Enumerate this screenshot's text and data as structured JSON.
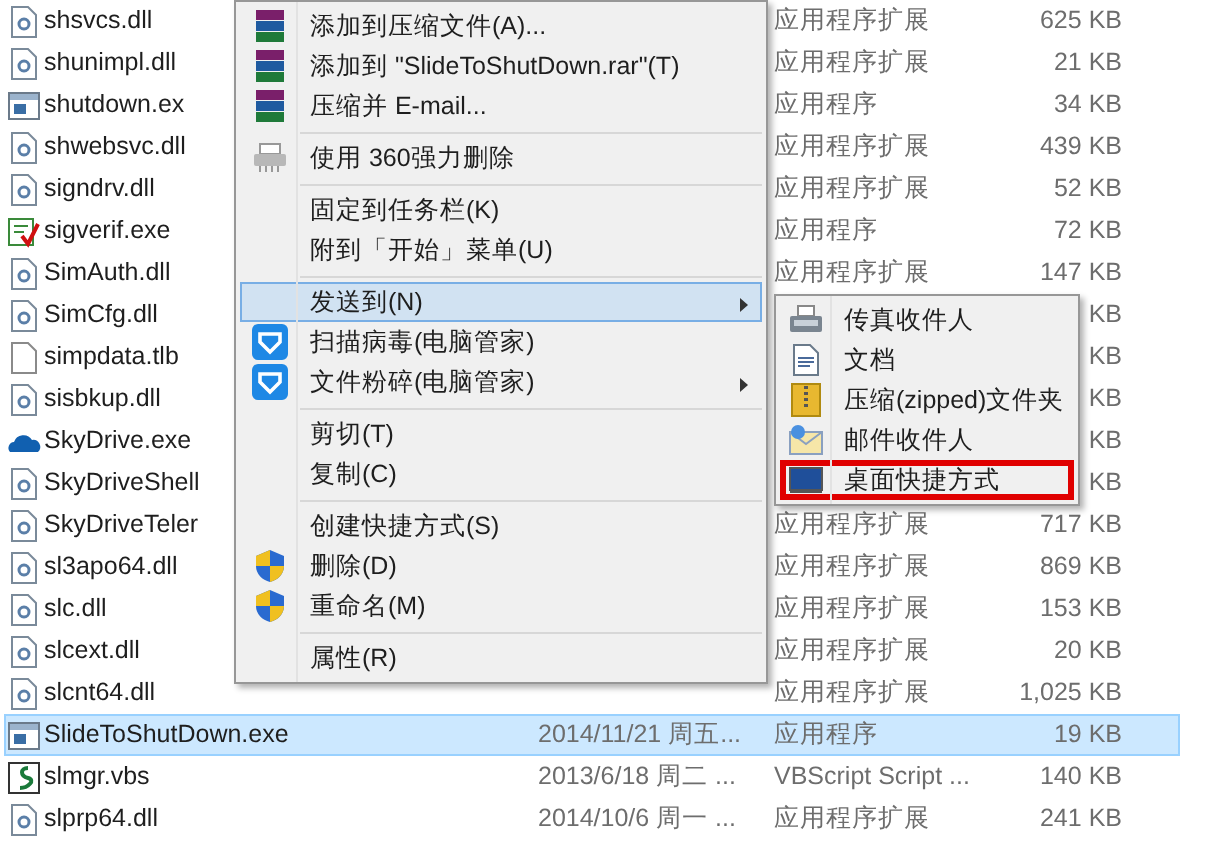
{
  "files": [
    {
      "name": "shsvcs.dll",
      "kind": "dll",
      "type": "应用程序扩展",
      "size": "625 KB",
      "selected": false
    },
    {
      "name": "shunimpl.dll",
      "kind": "dll",
      "type": "应用程序扩展",
      "size": "21 KB",
      "selected": false
    },
    {
      "name": "shutdown.ex",
      "kind": "exe",
      "type": "应用程序",
      "size": "34 KB",
      "selected": false
    },
    {
      "name": "shwebsvc.dll",
      "kind": "dll",
      "type": "应用程序扩展",
      "size": "439 KB",
      "selected": false
    },
    {
      "name": "signdrv.dll",
      "kind": "dll",
      "type": "应用程序扩展",
      "size": "52 KB",
      "selected": false
    },
    {
      "name": "sigverif.exe",
      "kind": "cert",
      "type": "应用程序",
      "size": "72 KB",
      "selected": false
    },
    {
      "name": "SimAuth.dll",
      "kind": "dll",
      "type": "应用程序扩展",
      "size": "147 KB",
      "selected": false
    },
    {
      "name": "SimCfg.dll",
      "kind": "dll",
      "size": "KB",
      "selected": false
    },
    {
      "name": "simpdata.tlb",
      "kind": "blank",
      "size": "KB",
      "selected": false
    },
    {
      "name": "sisbkup.dll",
      "kind": "dll",
      "size": "KB",
      "selected": false
    },
    {
      "name": "SkyDrive.exe",
      "kind": "cloud",
      "size": "KB",
      "selected": false
    },
    {
      "name": "SkyDriveShell",
      "kind": "dll",
      "size": "KB",
      "selected": false
    },
    {
      "name": "SkyDriveTeler",
      "kind": "dll",
      "type": "应用程序扩展",
      "size": "717 KB",
      "selected": false
    },
    {
      "name": "sl3apo64.dll",
      "kind": "dll",
      "type": "应用程序扩展",
      "size": "869 KB",
      "selected": false
    },
    {
      "name": "slc.dll",
      "kind": "dll",
      "type": "应用程序扩展",
      "size": "153 KB",
      "selected": false
    },
    {
      "name": "slcext.dll",
      "kind": "dll",
      "type": "应用程序扩展",
      "size": "20 KB",
      "selected": false
    },
    {
      "name": "slcnt64.dll",
      "kind": "dll",
      "type": "应用程序扩展",
      "size": "1,025 KB",
      "selected": false
    },
    {
      "name": "SlideToShutDown.exe",
      "kind": "exe",
      "date": "2014/11/21 周五...",
      "type": "应用程序",
      "size": "19 KB",
      "selected": true
    },
    {
      "name": "slmgr.vbs",
      "kind": "script",
      "date": "2013/6/18 周二 ...",
      "type": "VBScript Script ...",
      "size": "140 KB",
      "selected": false
    },
    {
      "name": "slprp64.dll",
      "kind": "dll",
      "date": "2014/10/6 周一 ...",
      "type": "应用程序扩展",
      "size": "241 KB",
      "selected": false
    }
  ],
  "context_menu": [
    {
      "kind": "winrar",
      "label": "添加到压缩文件(A)...",
      "selected": false,
      "submenu": false
    },
    {
      "kind": "winrar",
      "label": "添加到 \"SlideToShutDown.rar\"(T)",
      "selected": false,
      "submenu": false
    },
    {
      "kind": "winrar",
      "label": "压缩并 E-mail...",
      "selected": false,
      "submenu": false
    },
    {
      "kind": "separator"
    },
    {
      "kind": "shredder",
      "label": "使用 360强力删除",
      "selected": false,
      "submenu": false
    },
    {
      "kind": "separator"
    },
    {
      "kind": "plain",
      "label": "固定到任务栏(K)",
      "selected": false,
      "submenu": false
    },
    {
      "kind": "plain",
      "label": "附到「开始」菜单(U)",
      "selected": false,
      "submenu": false
    },
    {
      "kind": "separator"
    },
    {
      "kind": "plain",
      "label": "发送到(N)",
      "selected": true,
      "submenu": true
    },
    {
      "kind": "guard",
      "label": "扫描病毒(电脑管家)",
      "selected": false,
      "submenu": false
    },
    {
      "kind": "guard",
      "label": "文件粉碎(电脑管家)",
      "selected": false,
      "submenu": true
    },
    {
      "kind": "separator"
    },
    {
      "kind": "plain",
      "label": "剪切(T)",
      "selected": false,
      "submenu": false
    },
    {
      "kind": "plain",
      "label": "复制(C)",
      "selected": false,
      "submenu": false
    },
    {
      "kind": "separator"
    },
    {
      "kind": "plain",
      "label": "创建快捷方式(S)",
      "selected": false,
      "submenu": false
    },
    {
      "kind": "shield",
      "label": "删除(D)",
      "selected": false,
      "submenu": false
    },
    {
      "kind": "shield",
      "label": "重命名(M)",
      "selected": false,
      "submenu": false
    },
    {
      "kind": "separator"
    },
    {
      "kind": "plain",
      "label": "属性(R)",
      "selected": false,
      "submenu": false
    }
  ],
  "send_to_menu": [
    {
      "kind": "fax",
      "label": "传真收件人",
      "highlighted": false
    },
    {
      "kind": "document",
      "label": "文档",
      "highlighted": false
    },
    {
      "kind": "zip",
      "label": "压缩(zipped)文件夹",
      "highlighted": false
    },
    {
      "kind": "mail",
      "label": "邮件收件人",
      "highlighted": false
    },
    {
      "kind": "desktop",
      "label": "桌面快捷方式",
      "highlighted": true
    }
  ]
}
